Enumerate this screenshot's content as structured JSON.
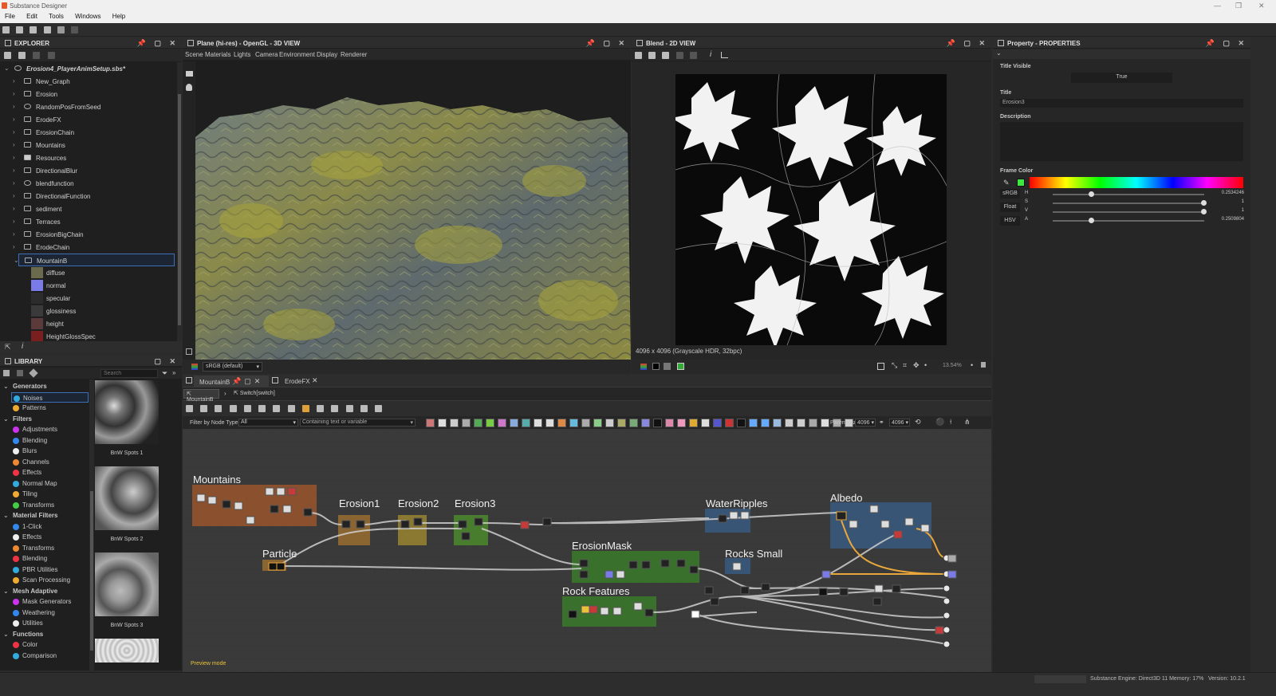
{
  "app": {
    "title": "Substance Designer"
  },
  "menu": [
    "File",
    "Edit",
    "Tools",
    "Windows",
    "Help"
  ],
  "explorer": {
    "title": "EXPLORER",
    "package": "Erosion4_PlayerAnimSetup.sbs*",
    "items": [
      {
        "label": "New_Graph"
      },
      {
        "label": "Erosion"
      },
      {
        "label": "RandomPosFromSeed"
      },
      {
        "label": "ErodeFX"
      },
      {
        "label": "ErosionChain"
      },
      {
        "label": "Mountains"
      },
      {
        "label": "Resources"
      },
      {
        "label": "DirectionalBlur"
      },
      {
        "label": "blendfunction"
      },
      {
        "label": "DirectionalFunction"
      },
      {
        "label": "sediment"
      },
      {
        "label": "Terraces"
      },
      {
        "label": "ErosionBigChain"
      },
      {
        "label": "ErodeChain"
      },
      {
        "label": "MountainB"
      }
    ],
    "outputs": [
      {
        "label": "diffuse",
        "color": "#6b6a4e"
      },
      {
        "label": "normal",
        "color": "#7b7be8"
      },
      {
        "label": "specular",
        "color": "#2c2c2c"
      },
      {
        "label": "glossiness",
        "color": "#3a3a3a"
      },
      {
        "label": "height",
        "color": "#5a3a3a"
      },
      {
        "label": "HeightGlossSpec",
        "color": "#7a1f1f"
      }
    ]
  },
  "library": {
    "title": "LIBRARY",
    "search_placeholder": "Search",
    "categories": [
      {
        "label": "Generators",
        "header": true
      },
      {
        "label": "Noises",
        "selected": true
      },
      {
        "label": "Patterns"
      },
      {
        "label": "Filters",
        "header": true
      },
      {
        "label": "Adjustments"
      },
      {
        "label": "Blending"
      },
      {
        "label": "Blurs"
      },
      {
        "label": "Channels"
      },
      {
        "label": "Effects"
      },
      {
        "label": "Normal Map"
      },
      {
        "label": "Tiling"
      },
      {
        "label": "Transforms"
      },
      {
        "label": "Material Filters",
        "header": true
      },
      {
        "label": "1-Click"
      },
      {
        "label": "Effects"
      },
      {
        "label": "Transforms"
      },
      {
        "label": "Blending"
      },
      {
        "label": "PBR Utilities"
      },
      {
        "label": "Scan Processing"
      },
      {
        "label": "Mesh Adaptive",
        "header": true
      },
      {
        "label": "Mask Generators"
      },
      {
        "label": "Weathering"
      },
      {
        "label": "Utilities"
      },
      {
        "label": "Functions",
        "header": true
      },
      {
        "label": "Color"
      },
      {
        "label": "Comparison"
      }
    ],
    "thumbs": [
      "BnW Spots 1",
      "BnW Spots 2",
      "BnW Spots 3"
    ]
  },
  "view3d": {
    "title": "Plane (hi-res) - OpenGL - 3D VIEW",
    "menu": [
      "Scene",
      "Materials",
      "Lights",
      "Camera",
      "Environment",
      "Display",
      "Renderer"
    ],
    "colorspace": "sRGB (default)"
  },
  "view2d": {
    "title": "Blend - 2D VIEW",
    "info": "4096 x 4096 (Grayscale HDR, 32bpc)",
    "zoom": "13.54%"
  },
  "properties": {
    "title": "Property - PROPERTIES",
    "title_visible_label": "Title Visible",
    "title_visible_value": "True",
    "title_label": "Title",
    "title_value": "Erosion3",
    "description_label": "Description",
    "frame_color_label": "Frame Color",
    "frame_color": "#3ee83e",
    "modes": [
      "sRGB",
      "Float",
      "HSV"
    ],
    "channels": [
      {
        "name": "H",
        "value": "0.2534246",
        "pos": 0.25
      },
      {
        "name": "S",
        "value": "1",
        "pos": 1
      },
      {
        "name": "V",
        "value": "1",
        "pos": 1
      },
      {
        "name": "A",
        "value": "0.2509804",
        "pos": 0.25
      }
    ]
  },
  "graph": {
    "tabs": [
      "MountainB",
      "ErodeFX"
    ],
    "breadcrumbs": [
      "MountainB",
      "Switch[switch]"
    ],
    "filter_label": "Filter by Node Type",
    "filter_value": "All",
    "text_filter": "Containing text or variable",
    "parent_size_label": "Parent Size:",
    "parent_size": "4096",
    "size_value": "4096",
    "frames": [
      "Mountains",
      "Erosion1",
      "Erosion2",
      "Erosion3",
      "WaterRipples",
      "Albedo",
      "Particle",
      "ErosionMask",
      "Rocks Small",
      "Rock Features"
    ],
    "preview_mode": "Preview mode"
  },
  "status": {
    "engine": "Substance Engine: Direct3D 11  Memory: 17%",
    "version": "Version: 10.2.1"
  }
}
